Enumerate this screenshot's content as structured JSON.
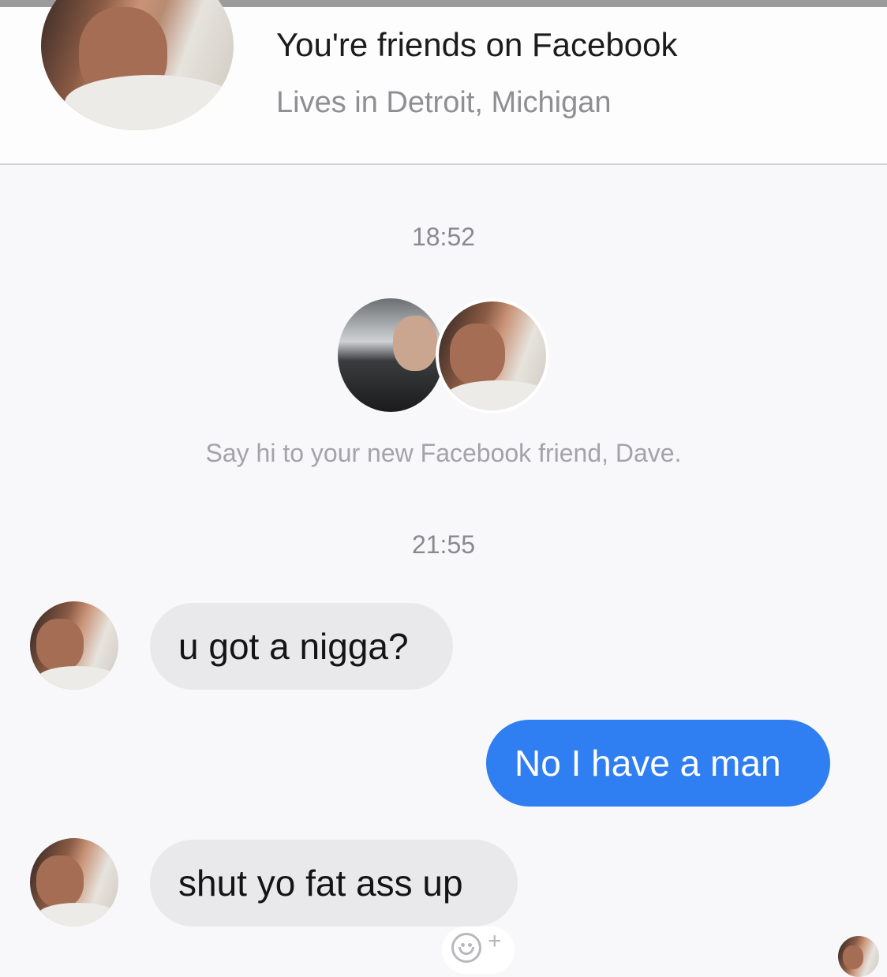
{
  "header": {
    "title": "You're friends on Facebook",
    "subtitle": "Lives in Detroit, Michigan"
  },
  "conversation": {
    "timestamp_1": "18:52",
    "system_message": "Say hi to your new Facebook friend, Dave.",
    "timestamp_2": "21:55",
    "messages": [
      {
        "sender": "contact",
        "text": "u got a nigga?"
      },
      {
        "sender": "me",
        "text": "No I have a man"
      },
      {
        "sender": "contact",
        "text": "shut yo fat ass up"
      }
    ]
  },
  "icons": {
    "reaction": "add-reaction-icon",
    "read_receipt": "avatar"
  },
  "colors": {
    "outgoing_bubble": "#2f7ef2",
    "incoming_bubble": "#e9e9eb",
    "background": "#f8f8fa"
  }
}
